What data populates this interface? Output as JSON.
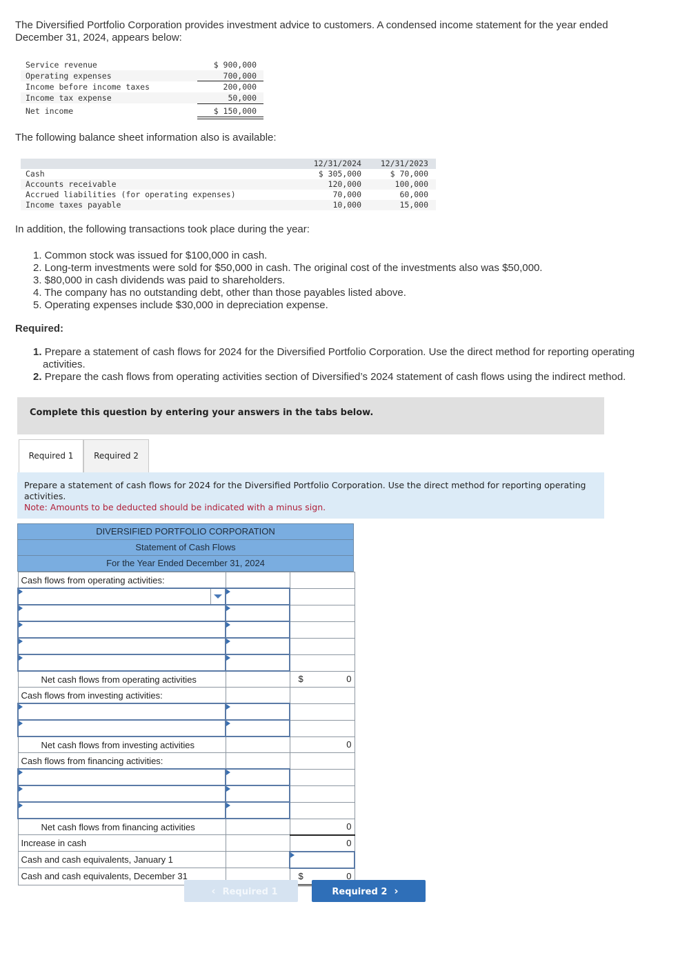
{
  "intro": "The Diversified Portfolio Corporation provides investment advice to customers. A condensed income statement for the year ended December 31, 2024, appears below:",
  "income_statement": [
    {
      "label": "Service revenue",
      "amount": "$ 900,000"
    },
    {
      "label": "Operating expenses",
      "amount": "700,000"
    },
    {
      "label": "Income before income taxes",
      "amount": "200,000"
    },
    {
      "label": "Income tax expense",
      "amount": "50,000"
    },
    {
      "label": "Net income",
      "amount": "$ 150,000"
    }
  ],
  "balance_intro": "The following balance sheet information also is available:",
  "balance_sheet": {
    "headers": [
      "12/31/2024",
      "12/31/2023"
    ],
    "rows": [
      {
        "label": "Cash",
        "y2024": "$ 305,000",
        "y2023": "$ 70,000"
      },
      {
        "label": "Accounts receivable",
        "y2024": "120,000",
        "y2023": "100,000"
      },
      {
        "label": "Accrued liabilities (for operating expenses)",
        "y2024": "70,000",
        "y2023": "60,000"
      },
      {
        "label": "Income taxes payable",
        "y2024": "10,000",
        "y2023": "15,000"
      }
    ]
  },
  "transactions_intro": "In addition, the following transactions took place during the year:",
  "transactions": [
    "1. Common stock was issued for $100,000 in cash.",
    "2. Long-term investments were sold for $50,000 in cash. The original cost of the investments also was $50,000.",
    "3. $80,000 in cash dividends was paid to shareholders.",
    "4. The company has no outstanding debt, other than those payables listed above.",
    "5. Operating expenses include $30,000 in depreciation expense."
  ],
  "required_heading": "Required:",
  "requirements": [
    {
      "num": "1.",
      "text": "Prepare a statement of cash flows for 2024 for the Diversified Portfolio Corporation. Use the direct method for reporting operating activities."
    },
    {
      "num": "2.",
      "text": "Prepare the cash flows from operating activities section of Diversified’s 2024 statement of cash flows using the indirect method."
    }
  ],
  "complete_box": "Complete this question by entering your answers in the tabs below.",
  "tabs": [
    {
      "label": "Required 1",
      "active": true
    },
    {
      "label": "Required 2",
      "active": false
    }
  ],
  "instruction": "Prepare a statement of cash flows for 2024 for the Diversified Portfolio Corporation. Use the direct method for reporting operating activities.",
  "note": "Note: Amounts to be deducted should be indicated with a minus sign.",
  "statement": {
    "company": "DIVERSIFIED PORTFOLIO CORPORATION",
    "title": "Statement of Cash Flows",
    "period": "For the Year Ended December 31, 2024",
    "operating_heading": "Cash flows from operating activities:",
    "net_operating_label": "Net cash flows from operating activities",
    "net_operating_value": "0",
    "investing_heading": "Cash flows from investing activities:",
    "net_investing_label": "Net cash flows from investing activities",
    "net_investing_value": "0",
    "financing_heading": "Cash flows from financing activities:",
    "net_financing_label": "Net cash flows from financing activities",
    "net_financing_value": "0",
    "increase_label": "Increase in cash",
    "increase_value": "0",
    "jan1_label": "Cash and cash equivalents, January 1",
    "jan1_value": "",
    "dec31_label": "Cash and cash equivalents, December 31",
    "dec31_value": "0",
    "currency": "$"
  },
  "nav": {
    "prev_label": "Required 1",
    "next_label": "Required 2",
    "prev_chevron": "‹",
    "next_chevron": "›"
  }
}
